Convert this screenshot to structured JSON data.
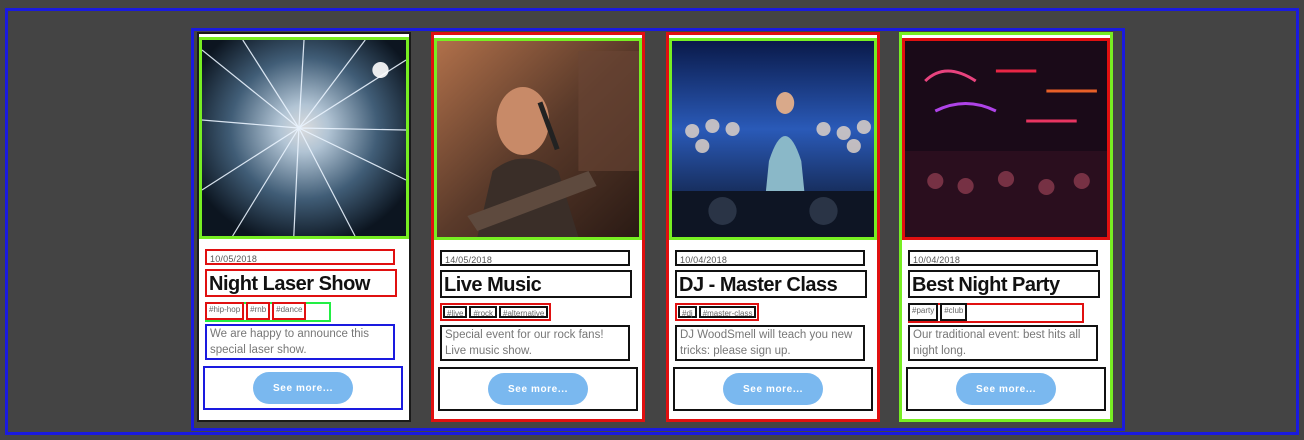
{
  "cards": [
    {
      "date": "10/05/2018",
      "title": "Night Laser Show",
      "tags": [
        "#hip-hop",
        "#rnb",
        "#dance"
      ],
      "description": "We are happy to announce this special laser show.",
      "button": "See more...",
      "image": "laser-light-show-photo"
    },
    {
      "date": "14/05/2018",
      "title": "Live Music",
      "tags": [
        "#live",
        "#rock",
        "#alternative"
      ],
      "description": "Special event for our rock fans! Live music show.",
      "button": "See more...",
      "image": "guitarist-singer-photo"
    },
    {
      "date": "10/04/2018",
      "title": "DJ - Master Class",
      "tags": [
        "#dj",
        "#master-class"
      ],
      "description": "DJ WoodSmell will teach you new tricks: please sign up.",
      "button": "See more...",
      "image": "dj-crowd-photo"
    },
    {
      "date": "10/04/2018",
      "title": "Best Night Party",
      "tags": [
        "#party",
        "#club"
      ],
      "description": "Our traditional event: best hits all night long.",
      "button": "See more...",
      "image": "neon-street-party-photo"
    }
  ],
  "colors": {
    "button": "#7ab8ef",
    "background": "#444444",
    "frame": "#1a1adf"
  }
}
